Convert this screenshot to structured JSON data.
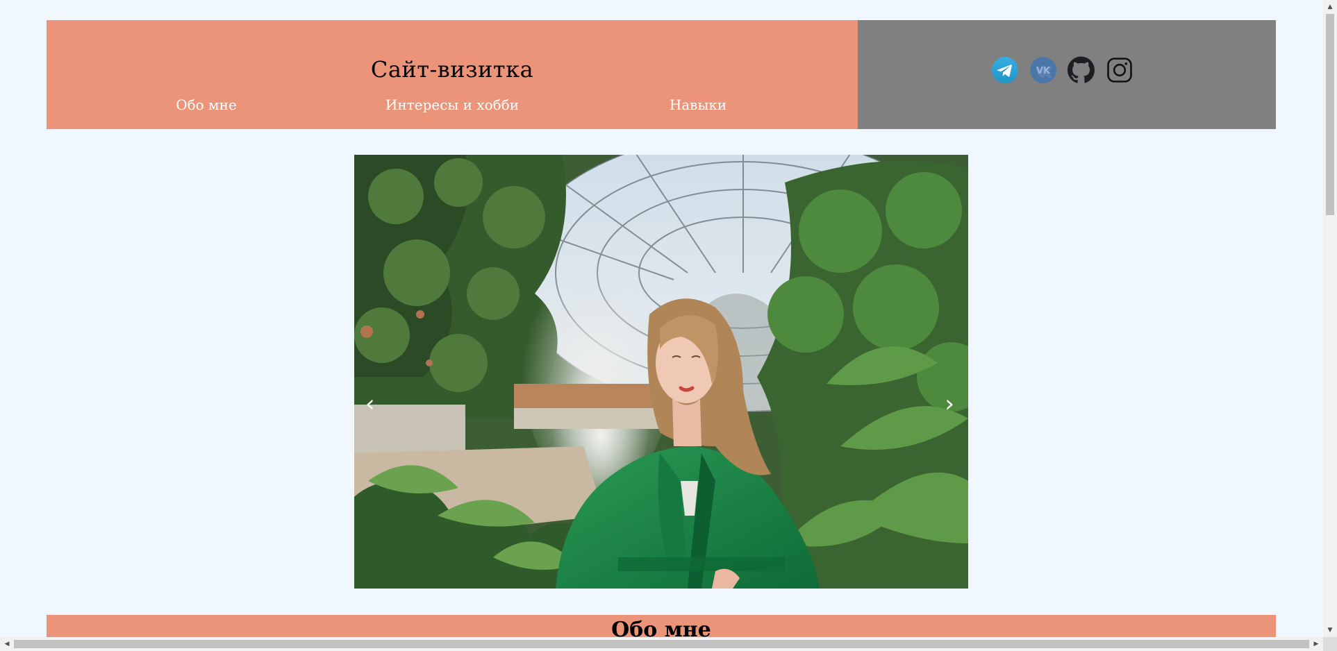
{
  "header": {
    "title": "Сайт-визитка",
    "nav": [
      {
        "label": "Обо мне"
      },
      {
        "label": "Интересы и хобби"
      },
      {
        "label": "Навыки"
      }
    ],
    "social_icons": [
      "telegram-icon",
      "vk-icon",
      "github-icon",
      "instagram-icon"
    ]
  },
  "slider": {
    "prev_label": "‹",
    "next_label": "›"
  },
  "sections": [
    {
      "title": "Обо мне"
    }
  ],
  "colors": {
    "accent": "#eb9479",
    "header_right": "#808080",
    "background": "#f0f7fe"
  }
}
